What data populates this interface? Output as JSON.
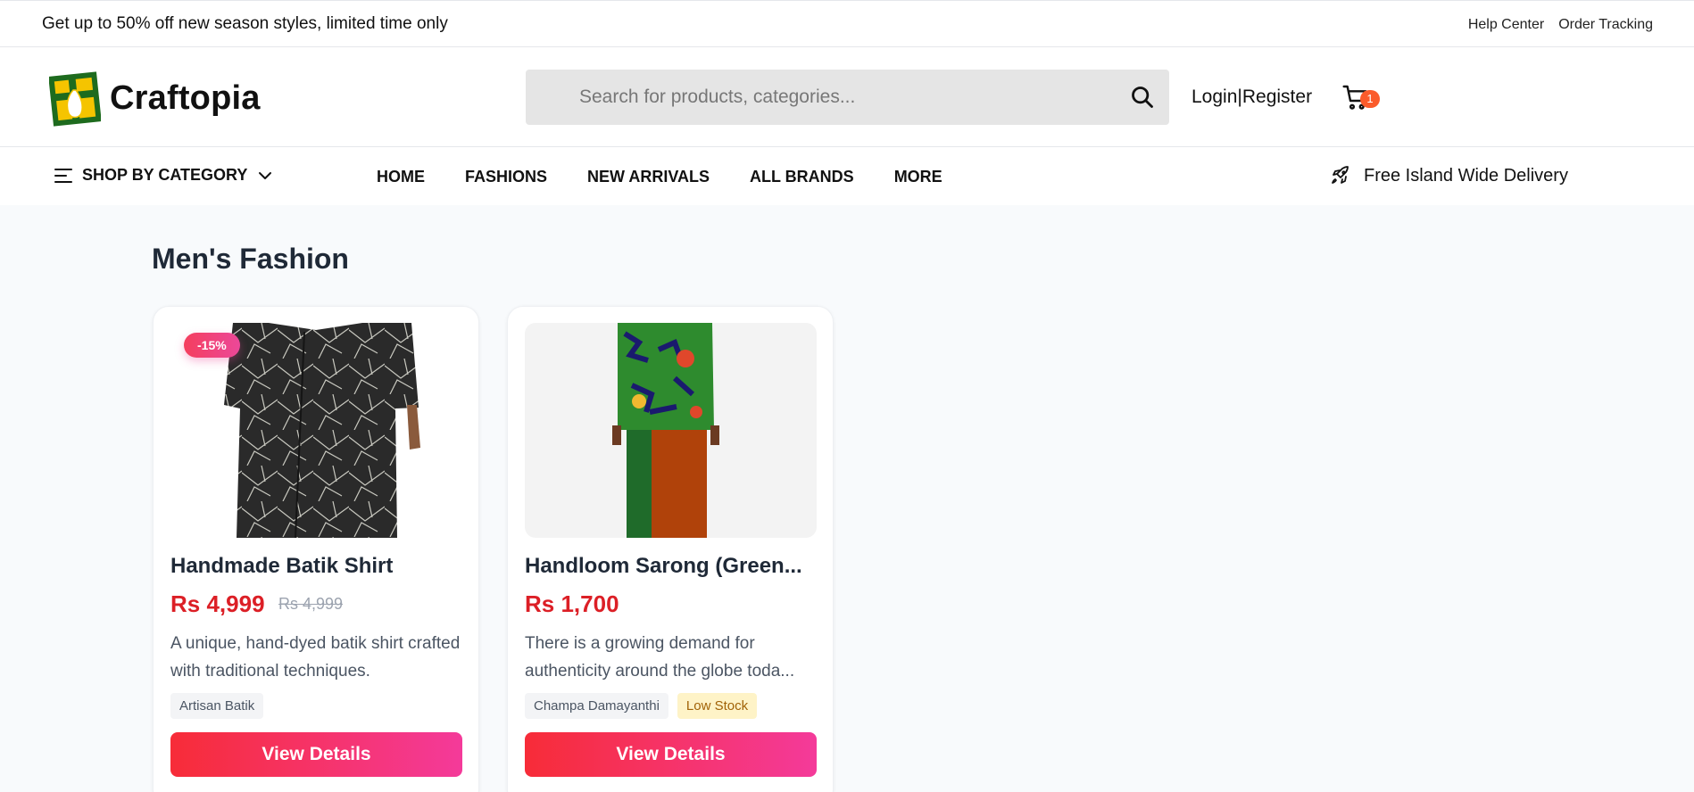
{
  "promo_bar": {
    "text": "Get up to 50% off new season styles, limited time only",
    "links": [
      "Help Center",
      "Order Tracking"
    ]
  },
  "header": {
    "brand": "Craftopia",
    "search_placeholder": "Search for products, categories...",
    "login": "Login",
    "separator": "|",
    "register": "Register",
    "cart_count": "1"
  },
  "nav": {
    "category_label": "SHOP BY CATEGORY",
    "items": [
      "HOME",
      "FASHIONS",
      "NEW ARRIVALS",
      "ALL BRANDS",
      "MORE"
    ],
    "delivery": "Free Island Wide Delivery"
  },
  "section": {
    "title": "Men's Fashion"
  },
  "products": [
    {
      "badge": "-15%",
      "title": "Handmade Batik Shirt",
      "price": "Rs 4,999",
      "old_price": "Rs 4,999",
      "description": "A unique, hand-dyed batik shirt crafted with traditional techniques.",
      "tags": [
        "Artisan Batik"
      ],
      "button": "View Details"
    },
    {
      "title": "Handloom Sarong (Green...",
      "price": "Rs 1,700",
      "description": "There is a growing demand for authenticity around the globe toda...",
      "tags": [
        "Champa Damayanthi",
        "Low Stock"
      ],
      "button": "View Details"
    }
  ],
  "colors": {
    "price": "#dc1f26",
    "button_gradient_start": "#f72c38",
    "button_gradient_end": "#f43a9a",
    "cart_badge": "#fb5b2b",
    "low_stock": "#fef3c7"
  }
}
